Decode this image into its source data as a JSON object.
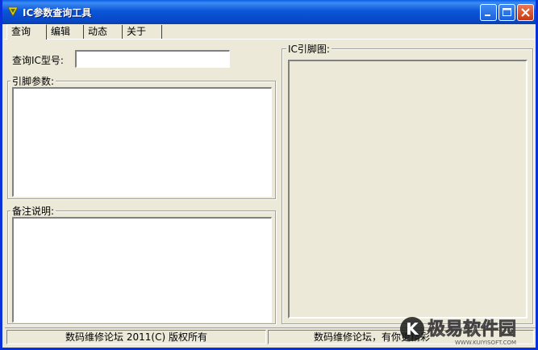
{
  "window": {
    "title": "IC参数查询工具"
  },
  "tabs": [
    {
      "label": "查询",
      "active": true
    },
    {
      "label": "编辑",
      "active": false
    },
    {
      "label": "动态",
      "active": false
    },
    {
      "label": "关于",
      "active": false
    }
  ],
  "query": {
    "ic_model_label": "查询IC型号:",
    "ic_model_value": "",
    "pin_params_label": "引脚参数:",
    "pin_params_value": "",
    "notes_label": "备注说明:",
    "notes_value": "",
    "pin_diagram_label": "IC引脚图:"
  },
  "statusbar": {
    "left_text": "数码维修论坛 2011(C) 版权所有",
    "right_text": "数码维修论坛，有你更精彩"
  },
  "watermark": {
    "text": "极易软件园",
    "url_text": "WWW.KUIYISOFT.COM"
  },
  "colors": {
    "titlebar": "#0A56D8",
    "window_bg": "#ECE9D8",
    "close_button": "#C23A14"
  }
}
